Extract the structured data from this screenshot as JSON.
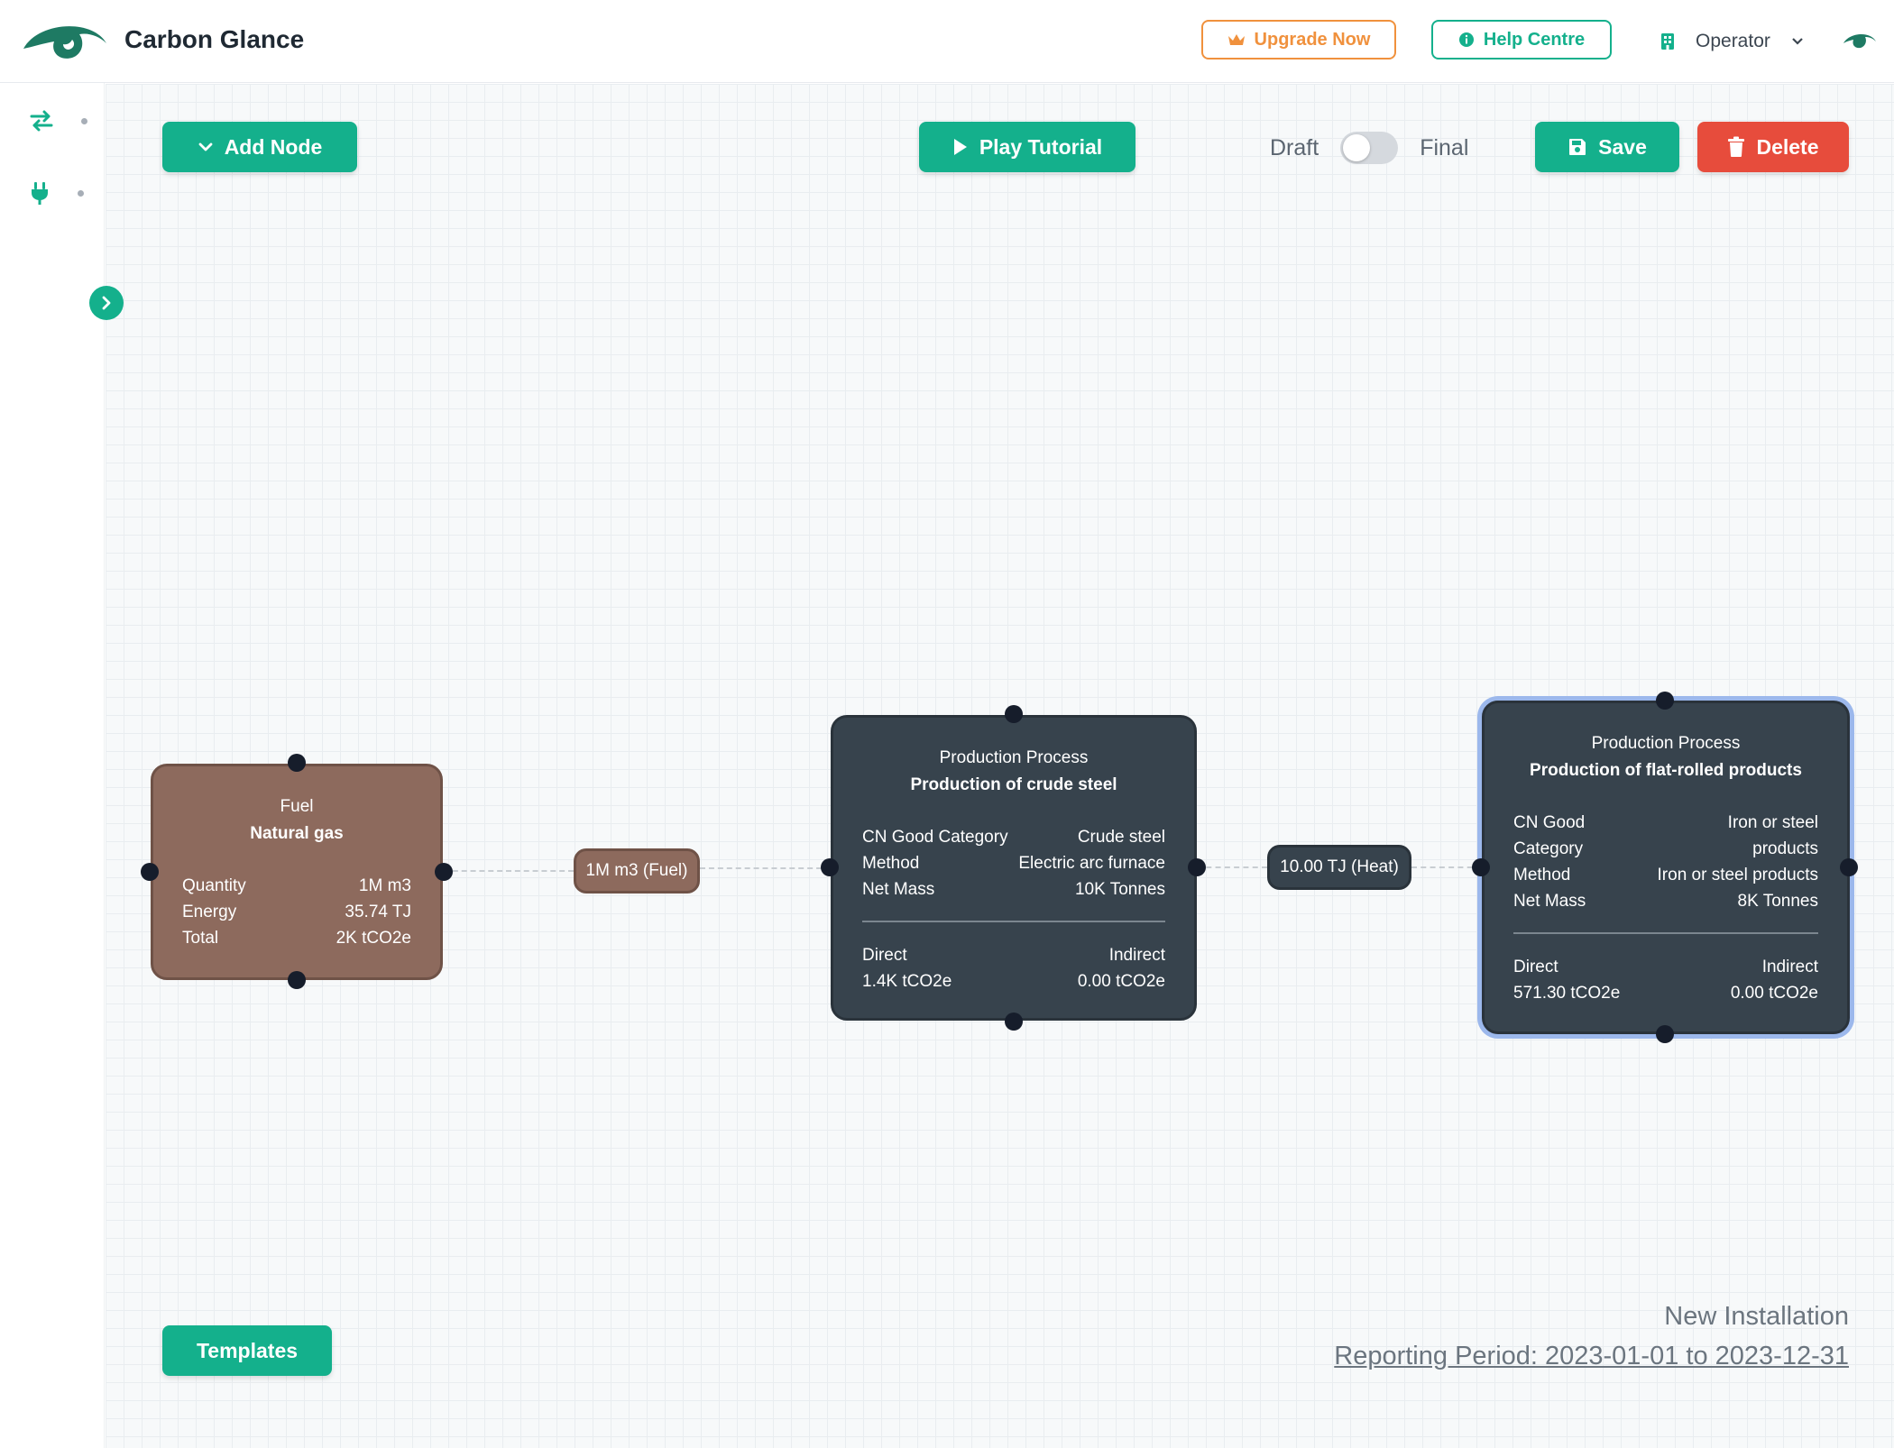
{
  "header": {
    "app_title": "Carbon Glance",
    "upgrade_label": "Upgrade Now",
    "help_label": "Help Centre",
    "role_label": "Operator",
    "accent_color": "#14b08c",
    "upgrade_color": "#f0913d"
  },
  "sidebar": {
    "items": [
      {
        "icon": "swap-arrows-icon"
      },
      {
        "icon": "plug-icon"
      }
    ]
  },
  "toolbar": {
    "add_node_label": "Add Node",
    "tutorial_label": "Play Tutorial",
    "draft_label": "Draft",
    "final_label": "Final",
    "save_label": "Save",
    "delete_label": "Delete",
    "templates_label": "Templates",
    "delete_color": "#e74c3c"
  },
  "nodes": {
    "fuel": {
      "type": "Fuel",
      "name": "Natural gas",
      "fields": [
        {
          "label": "Quantity",
          "value": "1M m3"
        },
        {
          "label": "Energy",
          "value": "35.74 TJ"
        },
        {
          "label": "Total",
          "value": "2K tCO2e"
        }
      ],
      "color": "#8d6a5d"
    },
    "crude": {
      "type": "Production Process",
      "name": "Production of crude steel",
      "fields": [
        {
          "label": "CN Good Category",
          "value": "Crude steel"
        },
        {
          "label": "Method",
          "value": "Electric arc furnace"
        },
        {
          "label": "Net Mass",
          "value": "10K Tonnes"
        }
      ],
      "direct_label": "Direct",
      "direct_value": "1.4K tCO2e",
      "indirect_label": "Indirect",
      "indirect_value": "0.00 tCO2e",
      "color": "#37434d"
    },
    "flat": {
      "type": "Production Process",
      "name": "Production of flat-rolled products",
      "cn_label_1": "CN Good",
      "cn_label_2": "Category",
      "cn_value_1": "Iron or steel",
      "cn_value_2": "products",
      "method_label": "Method",
      "method_value": "Iron or steel products",
      "mass_label": "Net Mass",
      "mass_value": "8K Tonnes",
      "direct_label": "Direct",
      "direct_value": "571.30 tCO2e",
      "indirect_label": "Indirect",
      "indirect_value": "0.00 tCO2e",
      "selected_outline": "#9cb8ec"
    }
  },
  "edges": {
    "fuel_to_crude": "1M m3 (Fuel)",
    "crude_to_flat": "10.00 TJ (Heat)"
  },
  "footer": {
    "installation": "New Installation",
    "reporting_period": "Reporting Period: 2023-01-01 to 2023-12-31"
  }
}
